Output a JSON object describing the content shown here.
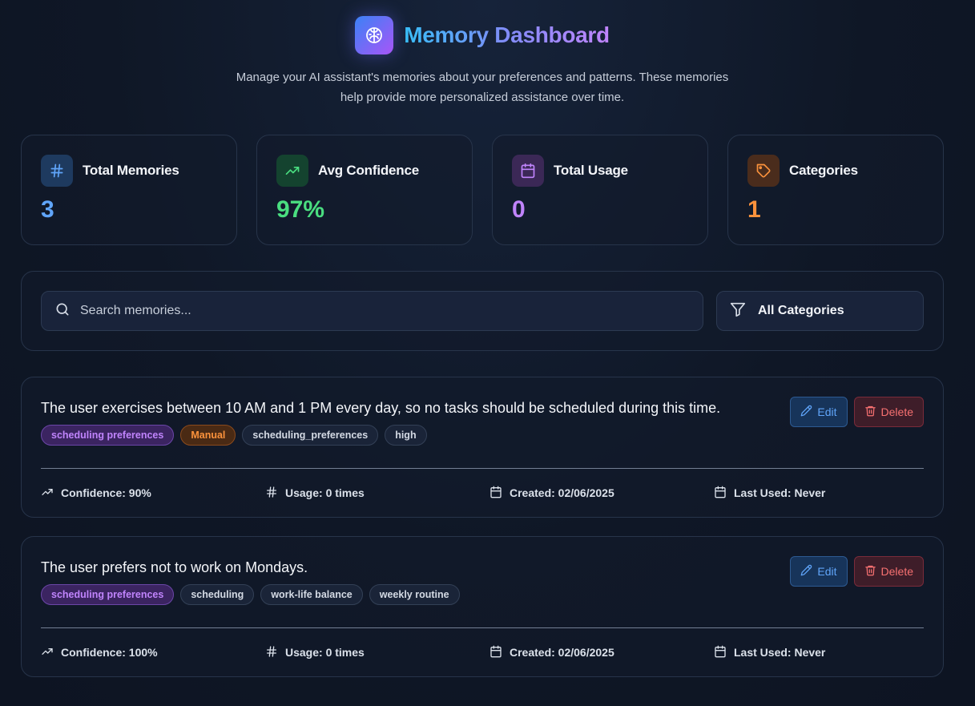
{
  "header": {
    "title": "Memory Dashboard",
    "subtitle": "Manage your AI assistant's memories about your preferences and patterns. These memories help provide more personalized assistance over time.",
    "logo_icon": "brain-icon"
  },
  "stats": [
    {
      "label": "Total Memories",
      "value": "3",
      "icon": "hash-icon",
      "color": "#60a5fa",
      "icon_bg": "#1e3a5f"
    },
    {
      "label": "Avg Confidence",
      "value": "97%",
      "icon": "trending-up-icon",
      "color": "#4ade80",
      "icon_bg": "#14432f"
    },
    {
      "label": "Total Usage",
      "value": "0",
      "icon": "calendar-icon",
      "color": "#c084fc",
      "icon_bg": "#3b2856"
    },
    {
      "label": "Categories",
      "value": "1",
      "icon": "tag-icon",
      "color": "#fb923c",
      "icon_bg": "#4a2c1c"
    }
  ],
  "filters": {
    "search_placeholder": "Search memories...",
    "category_selected": "All Categories"
  },
  "memories": [
    {
      "text": "The user exercises between 10 AM and 1 PM every day, so no tasks should be scheduled during this time.",
      "tags": [
        "scheduling preferences",
        "Manual",
        "scheduling_preferences",
        "high"
      ],
      "confidence": "Confidence: 90%",
      "usage": "Usage: 0 times",
      "created": "Created: 02/06/2025",
      "last_used": "Last Used: Never"
    },
    {
      "text": "The user prefers not to work on Mondays.",
      "tags": [
        "scheduling preferences",
        "scheduling",
        "work-life balance",
        "weekly routine"
      ],
      "confidence": "Confidence: 100%",
      "usage": "Usage: 0 times",
      "created": "Created: 02/06/2025",
      "last_used": "Last Used: Never"
    }
  ],
  "actions": {
    "edit_label": "Edit",
    "delete_label": "Delete"
  },
  "colors": {
    "accent_blue": "#60a5fa",
    "accent_purple": "#c084fc",
    "accent_orange": "#fb923c",
    "delete_red": "#f87171"
  }
}
